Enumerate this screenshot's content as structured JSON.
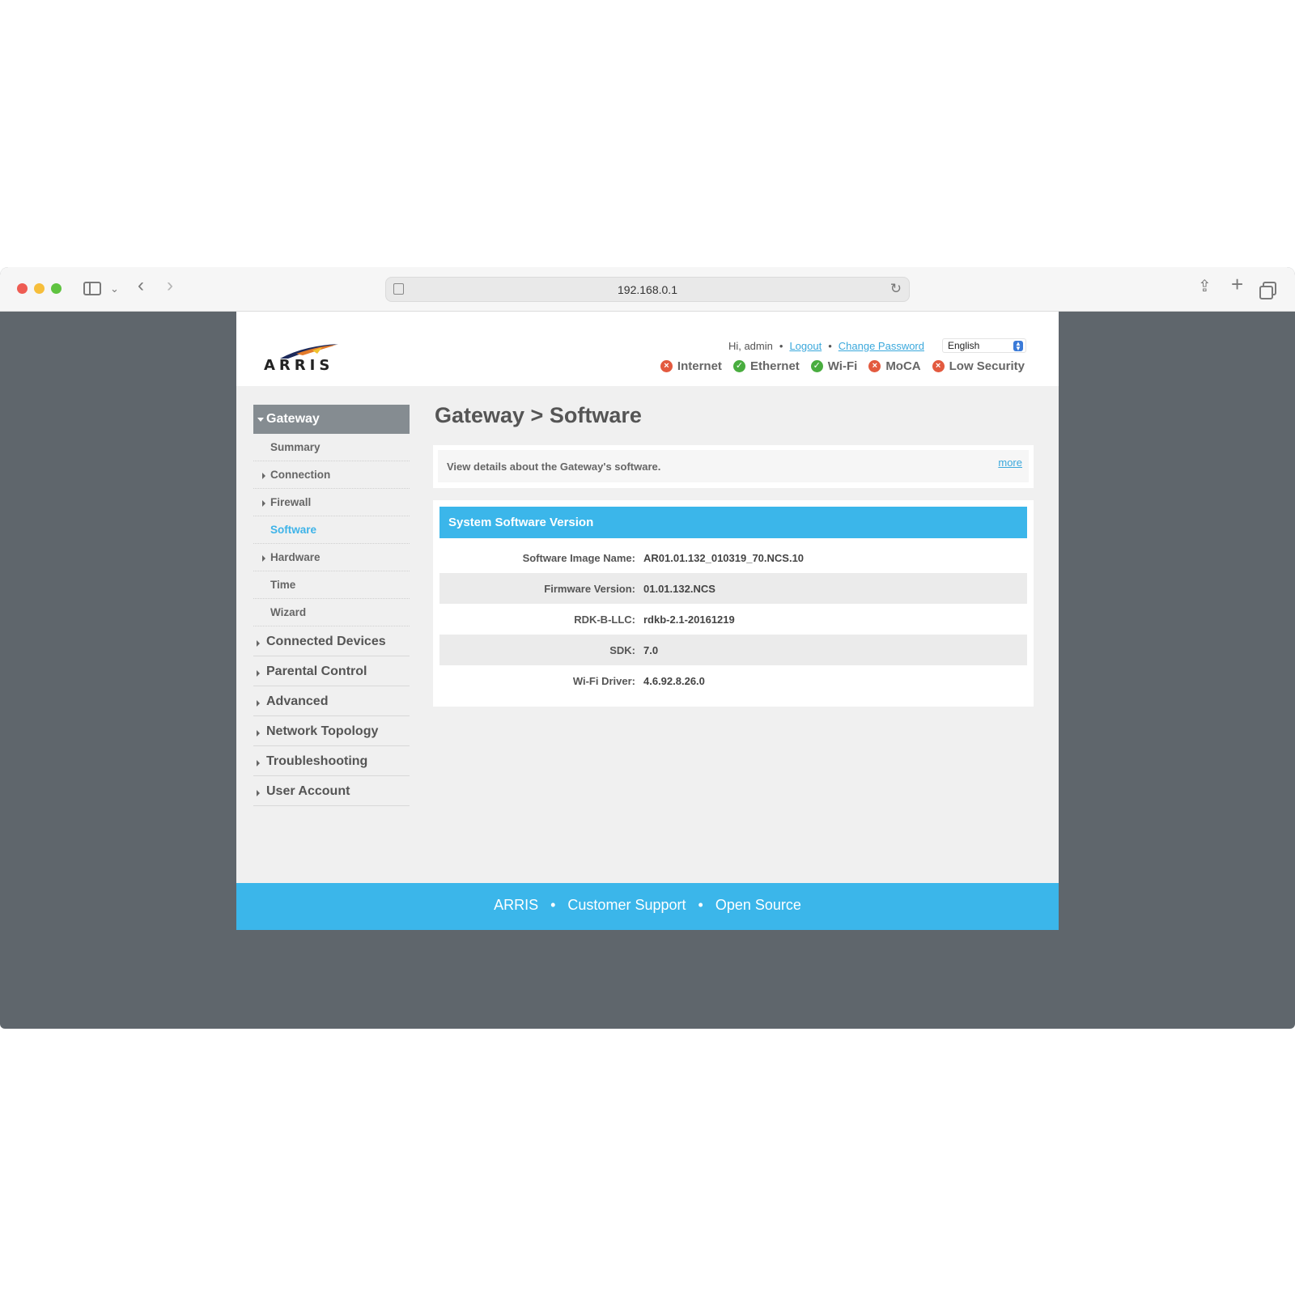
{
  "browser": {
    "url": "192.168.0.1"
  },
  "header": {
    "logo_text": "ARRIS",
    "greeting": "Hi, admin",
    "logout": "Logout",
    "change_password": "Change Password",
    "language": "English",
    "status": [
      {
        "label": "Internet",
        "state": "bad"
      },
      {
        "label": "Ethernet",
        "state": "good"
      },
      {
        "label": "Wi-Fi",
        "state": "good"
      },
      {
        "label": "MoCA",
        "state": "bad"
      },
      {
        "label": "Low Security",
        "state": "bad"
      }
    ]
  },
  "nav": {
    "top": "Gateway",
    "sub": [
      "Summary",
      "Connection",
      "Firewall",
      "Software",
      "Hardware",
      "Time",
      "Wizard"
    ],
    "main": [
      "Connected Devices",
      "Parental Control",
      "Advanced",
      "Network Topology",
      "Troubleshooting",
      "User Account"
    ]
  },
  "content": {
    "title": "Gateway > Software",
    "description": "View details about the Gateway's software.",
    "more": "more",
    "section_title": "System Software Version",
    "rows": [
      {
        "label": "Software Image Name:",
        "value": "AR01.01.132_010319_70.NCS.10"
      },
      {
        "label": "Firmware Version:",
        "value": "01.01.132.NCS"
      },
      {
        "label": "RDK-B-LLC:",
        "value": "rdkb-2.1-20161219"
      },
      {
        "label": "SDK:",
        "value": "7.0"
      },
      {
        "label": "Wi-Fi Driver:",
        "value": "4.6.92.8.26.0"
      }
    ]
  },
  "footer": {
    "links": [
      "ARRIS",
      "Customer Support",
      "Open Source"
    ],
    "separator": "•"
  },
  "colors": {
    "accent": "#3bb6ea",
    "nav_active": "#3eb3e8",
    "status_good": "#49ad3f",
    "status_bad": "#e35a3f",
    "browser_bg": "#5f666c"
  }
}
